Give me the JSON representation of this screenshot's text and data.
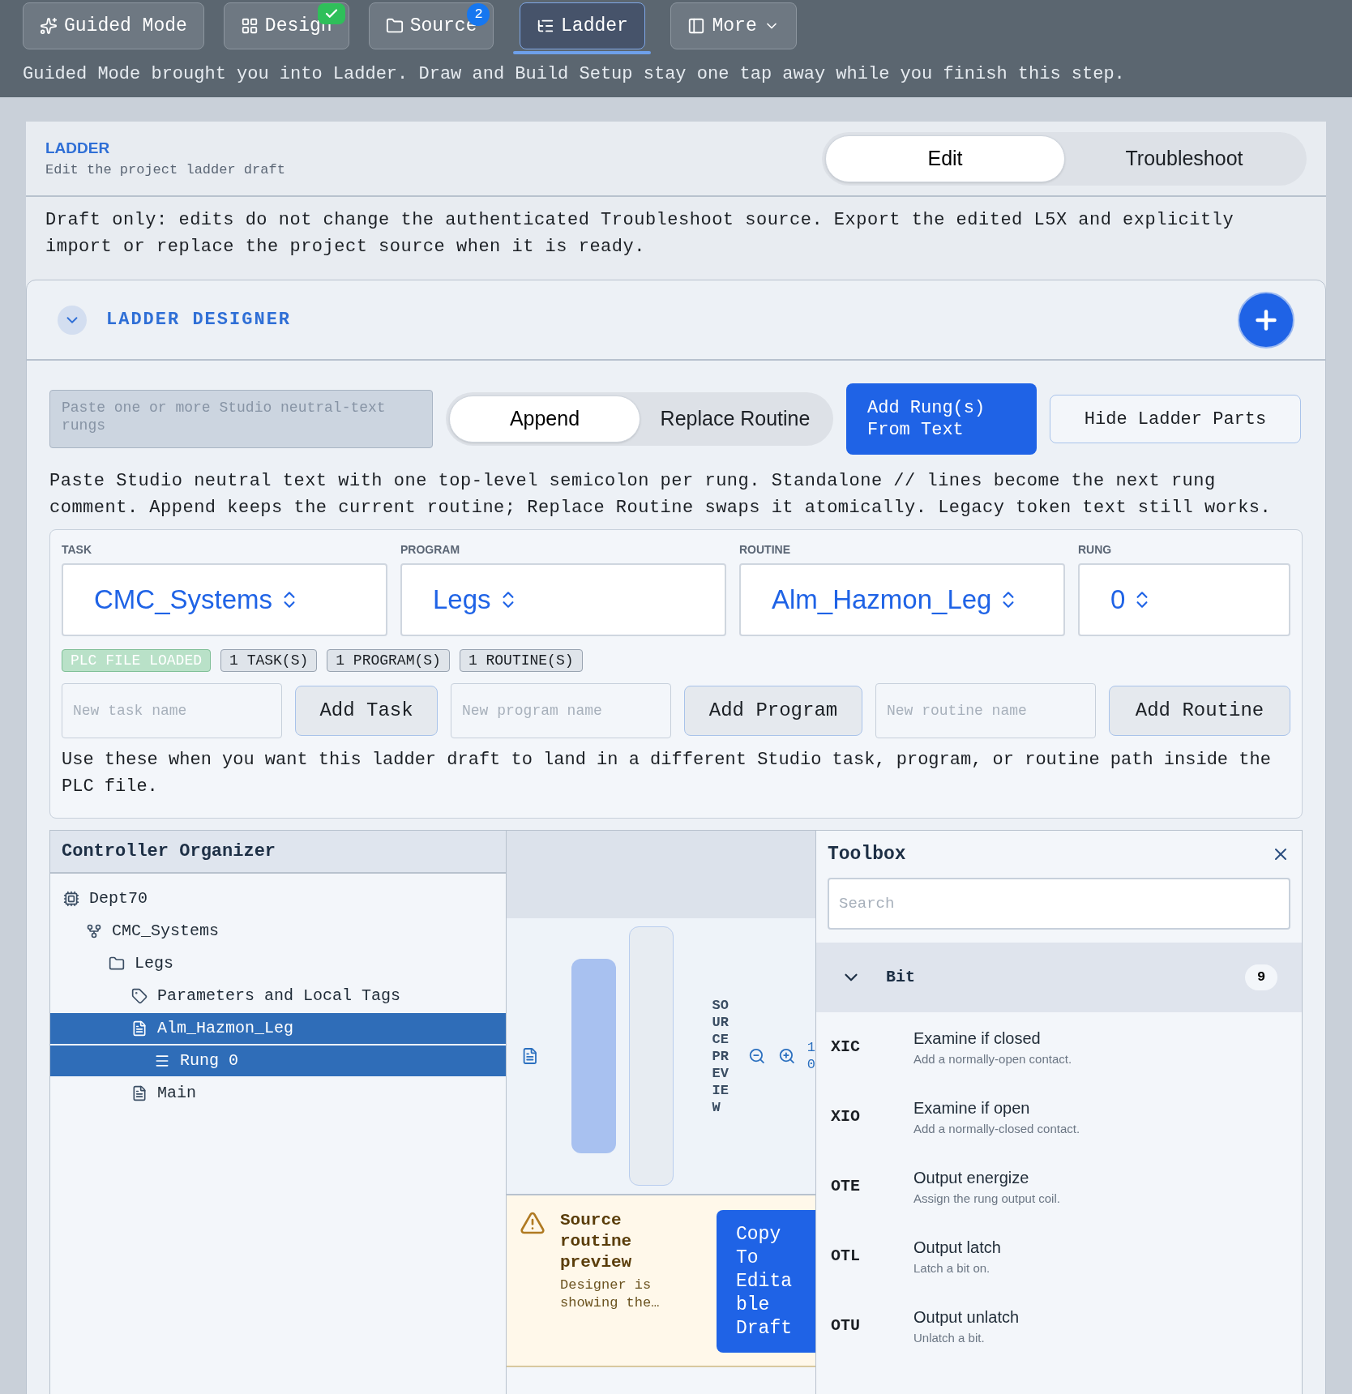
{
  "nav": {
    "tabs": [
      {
        "label": "Guided Mode",
        "selected": false
      },
      {
        "label": "Design",
        "selected": false,
        "badge": {
          "kind": "check"
        }
      },
      {
        "label": "Source",
        "selected": false,
        "badge": {
          "kind": "count",
          "text": "2"
        }
      },
      {
        "label": "Ladder",
        "selected": true
      },
      {
        "label": "More",
        "selected": false,
        "dropdown": true
      }
    ],
    "message": "Guided Mode brought you into Ladder. Draw and Build Setup stay one tap away while you finish this step."
  },
  "header": {
    "eyebrow": "LADDER",
    "subtitle": "Edit the project ladder draft",
    "modes": [
      {
        "label": "Edit",
        "selected": true
      },
      {
        "label": "Troubleshoot",
        "selected": false
      }
    ]
  },
  "notice": "Draft only: edits do not change the authenticated Troubleshoot source. Export the edited L5X and explicitly import or replace the project source when it is ready.",
  "designer": {
    "title": "LADDER DESIGNER",
    "expanded": true,
    "paste_field": {
      "placeholder": "Paste one or more Studio neutral-text rungs"
    },
    "insert_modes": [
      {
        "label": "Append",
        "selected": true
      },
      {
        "label": "Replace Routine",
        "selected": false
      }
    ],
    "add_button": "Add Rung(s) From Text",
    "hide_button": "Hide Ladder Parts",
    "help": "Paste Studio neutral text with one top-level semicolon per rung. Standalone // lines become the next rung comment. Append keeps the current routine; Replace Routine swaps it atomically. Legacy token text still works.",
    "selectors": [
      {
        "label": "TASK",
        "value": "CMC_Systems"
      },
      {
        "label": "PROGRAM",
        "value": "Legs"
      },
      {
        "label": "ROUTINE",
        "value": "Alm_Hazmon_Leg"
      },
      {
        "label": "RUNG",
        "value": "0"
      }
    ],
    "badges": [
      {
        "text": "PLC FILE LOADED",
        "kind": "status"
      },
      {
        "text": "1 TASK(S)",
        "kind": "count"
      },
      {
        "text": "1 PROGRAM(S)",
        "kind": "count"
      },
      {
        "text": "1 ROUTINE(S)",
        "kind": "count"
      }
    ],
    "creators": [
      {
        "placeholder": "New task name",
        "button": "Add Task"
      },
      {
        "placeholder": "New program name",
        "button": "Add Program"
      },
      {
        "placeholder": "New routine name",
        "button": "Add Routine"
      }
    ],
    "creator_help": "Use these when you want this ladder draft to land in a different Studio task, program, or routine path inside the PLC file."
  },
  "organizer": {
    "title": "Controller Organizer",
    "tree": [
      {
        "label": "Dept70",
        "kind": "controller",
        "selected": false,
        "children": [
          {
            "label": "CMC_Systems",
            "kind": "task",
            "selected": false,
            "children": [
              {
                "label": "Legs",
                "kind": "program",
                "selected": false,
                "children": [
                  {
                    "label": "Parameters and Local Tags",
                    "kind": "tags",
                    "selected": false
                  },
                  {
                    "label": "Alm_Hazmon_Leg",
                    "kind": "routine",
                    "selected": true,
                    "children": [
                      {
                        "label": "Rung 0",
                        "kind": "rung",
                        "selected": true
                      }
                    ]
                  },
                  {
                    "label": "Main",
                    "kind": "routine",
                    "selected": false
                  }
                ]
              }
            ]
          }
        ]
      }
    ]
  },
  "preview": {
    "label": "SOURCE PREVIEW",
    "zoom": "10",
    "warning": {
      "title": "Source routine preview",
      "text": "Designer is showing the…",
      "button": "Copy To Editable Draft"
    }
  },
  "toolbox": {
    "title": "Toolbox",
    "search": {
      "placeholder": "Search"
    },
    "group": {
      "name": "Bit",
      "count": "9",
      "expanded": true
    },
    "items": [
      {
        "code": "XIC",
        "name": "Examine if closed",
        "description": "Add a normally-open contact."
      },
      {
        "code": "XIO",
        "name": "Examine if open",
        "description": "Add a normally-closed contact."
      },
      {
        "code": "OTE",
        "name": "Output energize",
        "description": "Assign the rung output coil."
      },
      {
        "code": "OTL",
        "name": "Output latch",
        "description": "Latch a bit on."
      },
      {
        "code": "OTU",
        "name": "Output unlatch",
        "description": "Unlatch a bit."
      }
    ]
  }
}
